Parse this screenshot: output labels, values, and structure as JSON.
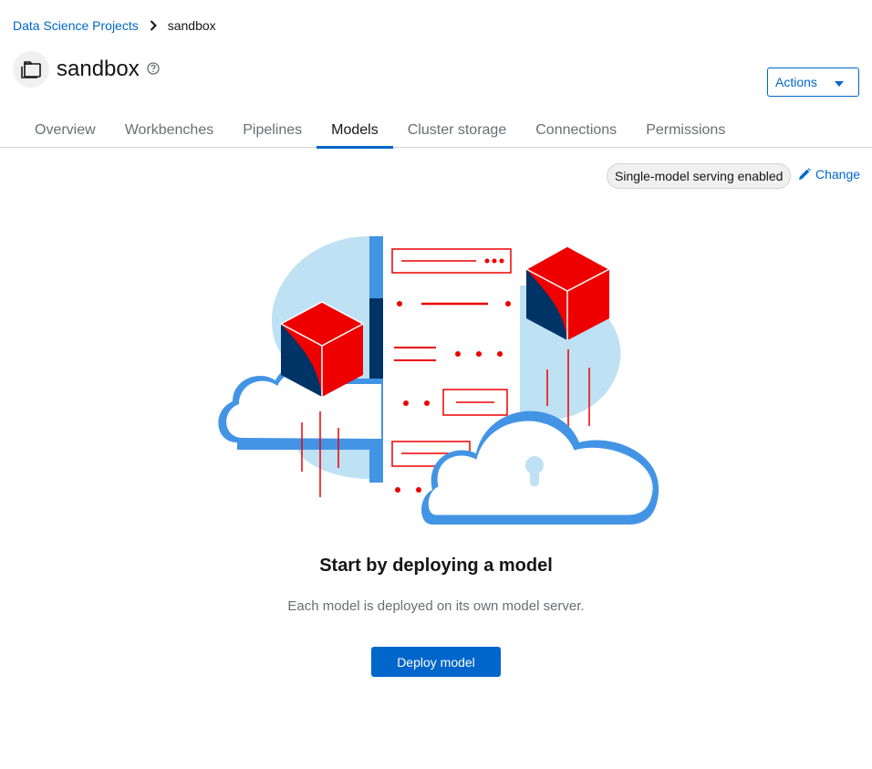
{
  "breadcrumb": {
    "parent": "Data Science Projects",
    "current": "sandbox"
  },
  "header": {
    "title": "sandbox",
    "icon": "project-icon",
    "help_icon": "help-icon"
  },
  "actions": {
    "label": "Actions",
    "icon": "caret-down-icon"
  },
  "tabs": [
    {
      "label": "Overview",
      "active": false
    },
    {
      "label": "Workbenches",
      "active": false
    },
    {
      "label": "Pipelines",
      "active": false
    },
    {
      "label": "Models",
      "active": true
    },
    {
      "label": "Cluster storage",
      "active": false
    },
    {
      "label": "Connections",
      "active": false
    },
    {
      "label": "Permissions",
      "active": false
    }
  ],
  "serving": {
    "badge": "Single-model serving enabled",
    "change_label": "Change",
    "change_icon": "pencil-icon"
  },
  "empty_state": {
    "title": "Start by deploying a model",
    "body": "Each model is deployed on its own model server.",
    "button": "Deploy model"
  },
  "colors": {
    "link": "#0066cc",
    "accent_red": "#ee0000",
    "navy": "#003366",
    "light_blue": "#bee1f4",
    "mid_blue": "#4394e5"
  }
}
